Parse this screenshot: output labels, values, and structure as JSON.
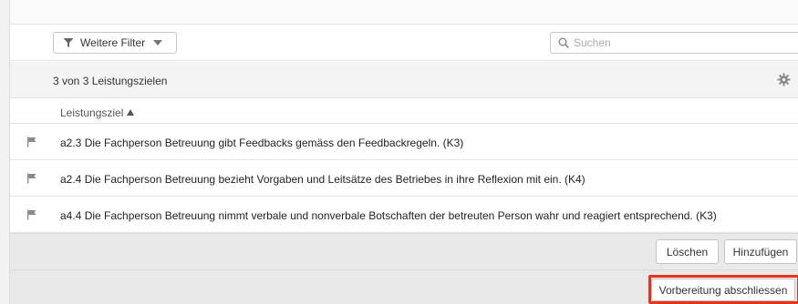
{
  "filter": {
    "label": "Weitere Filter"
  },
  "search": {
    "placeholder": "Suchen",
    "value": ""
  },
  "list": {
    "count_text": "3 von 3 Leistungszielen",
    "column_header": "Leistungsziel",
    "rows": [
      {
        "text": "a2.3 Die Fachperson Betreuung gibt Feedbacks gemäss den Feedbackregeln. (K3)"
      },
      {
        "text": "a2.4 Die Fachperson Betreuung bezieht Vorgaben und Leitsätze des Betriebes in ihre Reflexion mit ein. (K4)"
      },
      {
        "text": "a4.4 Die Fachperson Betreuung nimmt verbale und nonverbale Botschaften der betreuten Person wahr und reagiert entsprechend. (K3)"
      }
    ]
  },
  "actions": {
    "delete_label": "Löschen",
    "add_label": "Hinzufügen"
  },
  "footer": {
    "finish_label": "Vorbereitung abschliessen"
  },
  "colors": {
    "highlight": "#e8331c",
    "icon": "#888888"
  },
  "icons": {
    "filter": "funnel-icon",
    "filter_dropdown": "caret-down-icon",
    "search": "magnifier-icon",
    "settings": "gear-icon",
    "sort": "sort-ascending-icon",
    "row": "flag-icon"
  }
}
